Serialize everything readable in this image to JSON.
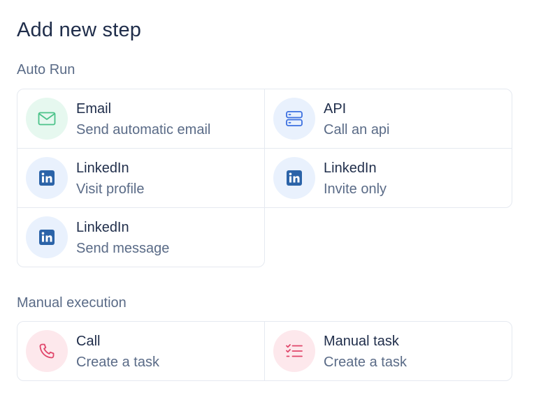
{
  "page": {
    "title": "Add new step"
  },
  "auto_run": {
    "label": "Auto Run",
    "items": [
      {
        "name": "Email",
        "description": "Send automatic email",
        "icon": "mail-icon",
        "color": "#4cc38a"
      },
      {
        "name": "API",
        "description": "Call an api",
        "icon": "server-icon",
        "color": "#3b6fe0"
      },
      {
        "name": "LinkedIn",
        "description": "Visit profile",
        "icon": "linkedin-icon",
        "color": "#2b63a8"
      },
      {
        "name": "LinkedIn",
        "description": "Invite only",
        "icon": "linkedin-icon",
        "color": "#2b63a8"
      },
      {
        "name": "LinkedIn",
        "description": "Send message",
        "icon": "linkedin-icon",
        "color": "#2b63a8"
      }
    ]
  },
  "manual": {
    "label": "Manual execution",
    "items": [
      {
        "name": "Call",
        "description": "Create a task",
        "icon": "phone-icon",
        "color": "#e0456a"
      },
      {
        "name": "Manual task",
        "description": "Create a task",
        "icon": "checklist-icon",
        "color": "#e0456a"
      }
    ]
  }
}
